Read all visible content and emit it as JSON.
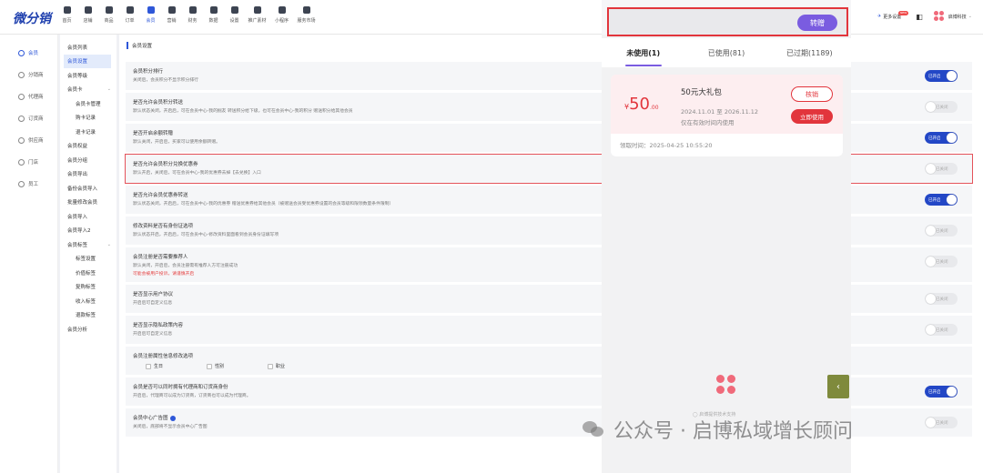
{
  "header": {
    "logo": "微分销",
    "nav": [
      "首页",
      "店铺",
      "商品",
      "订单",
      "会员",
      "营销",
      "财务",
      "数据",
      "设置",
      "推广素材",
      "小程序",
      "服务市场"
    ],
    "active_nav": "会员",
    "more_settings": "更多设置",
    "new_badge": "NEW",
    "company": "启博科技"
  },
  "sidebar": {
    "items": [
      "会员",
      "分销商",
      "代理商",
      "订货商",
      "供应商",
      "门店",
      "员工"
    ],
    "active": "会员"
  },
  "submenu": {
    "items": [
      {
        "label": "会员列表",
        "type": "item"
      },
      {
        "label": "会员设置",
        "type": "active"
      },
      {
        "label": "会员等级",
        "type": "item"
      },
      {
        "label": "会员卡",
        "type": "group"
      },
      {
        "label": "会员卡管理",
        "type": "child"
      },
      {
        "label": "购卡记录",
        "type": "child"
      },
      {
        "label": "退卡记录",
        "type": "child"
      },
      {
        "label": "会员权益",
        "type": "item"
      },
      {
        "label": "会员分组",
        "type": "item"
      },
      {
        "label": "会员导出",
        "type": "item"
      },
      {
        "label": "备份会员导入",
        "type": "item"
      },
      {
        "label": "批量修改会员",
        "type": "item"
      },
      {
        "label": "会员导入",
        "type": "item"
      },
      {
        "label": "会员导入2",
        "type": "item"
      },
      {
        "label": "会员标签",
        "type": "group"
      },
      {
        "label": "标签设置",
        "type": "child"
      },
      {
        "label": "价值标签",
        "type": "child"
      },
      {
        "label": "复购标签",
        "type": "child"
      },
      {
        "label": "收入标签",
        "type": "child"
      },
      {
        "label": "退款标签",
        "type": "child"
      },
      {
        "label": "会员分析",
        "type": "item"
      }
    ]
  },
  "main": {
    "section_title": "会员设置",
    "toggle_on": "已开启",
    "toggle_off": "已关闭",
    "rows": [
      {
        "title": "会员积分排行",
        "desc": "关闭后，会员积分不显示积分排行",
        "on": true
      },
      {
        "title": "是否允许会员积分转送",
        "desc": "默认状态关闭，开启后，可在会员中心-我的掘友 转送积分给下级，也可在会员中心-我的积分 赠送积分给其他会员",
        "on": false
      },
      {
        "title": "是否开启余额转赠",
        "desc": "默认关闭，开启后，买家可以使用余额转赠。",
        "on": true
      },
      {
        "title": "是否允许会员积分兑换优惠券",
        "desc": "默认开启，关闭后，可在会员中心-我的优惠券去掉【去兑换】入口",
        "on": false,
        "highlight": true
      },
      {
        "title": "是否允许会员优惠券转送",
        "desc": "默认状态关闭，开启后，可在会员中心-我的优惠券 赠送优惠券给其他会员（被赠送会员受优惠券设置的会员等级和限领数量条件限制）",
        "on": true
      },
      {
        "title": "修改资料是否有身份证选项",
        "desc": "默认状态开启，开启后，可在会员中心-修改资料里面看到会员身份证填写项",
        "on": false
      },
      {
        "title": "会员注册是否需要推荐人",
        "desc": "默认关闭，开启后，会员注册需有推荐人方可注册成功",
        "warn": "可能会被用户投诉，请谨慎开启",
        "on": false
      },
      {
        "title": "是否显示用户协议",
        "desc": "开启后可自定义信息",
        "on": false
      },
      {
        "title": "是否显示隐私政策内容",
        "desc": "开启后可自定义信息",
        "on": false
      },
      {
        "title": "会员注册属性信息修改选项",
        "checks": [
          "生日",
          "性别",
          "职业"
        ]
      },
      {
        "title": "会员是否可以同时拥有代理商和订货商身份",
        "desc": "开启后，代理商可以成为订货商，订货商也可以成为代理商。",
        "on": true
      },
      {
        "title": "会员中心广告图",
        "desc": "关闭后，底部将不显示会员中心广告图",
        "on": false,
        "info": true
      }
    ]
  },
  "phone": {
    "transfer_btn": "转赠",
    "tabs": [
      "未使用(1)",
      "已使用(81)",
      "已过期(1189)"
    ],
    "coupon": {
      "currency": "¥",
      "amount": "50",
      "decimals": ".00",
      "name": "50元大礼包",
      "date_range": "2024.11.01 至 2026.11.12",
      "note": "仅在有效时间内使用",
      "verify_btn": "核销",
      "use_btn": "立即使用",
      "received": "领取时间：2025-04-25 10:55:20"
    },
    "support": "启博提供技术支持"
  },
  "watermark": "公众号 · 启博私域增长顾问",
  "colors": {
    "primary": "#2e57d8",
    "accent": "#7a5ce0",
    "danger": "#e2353c"
  }
}
